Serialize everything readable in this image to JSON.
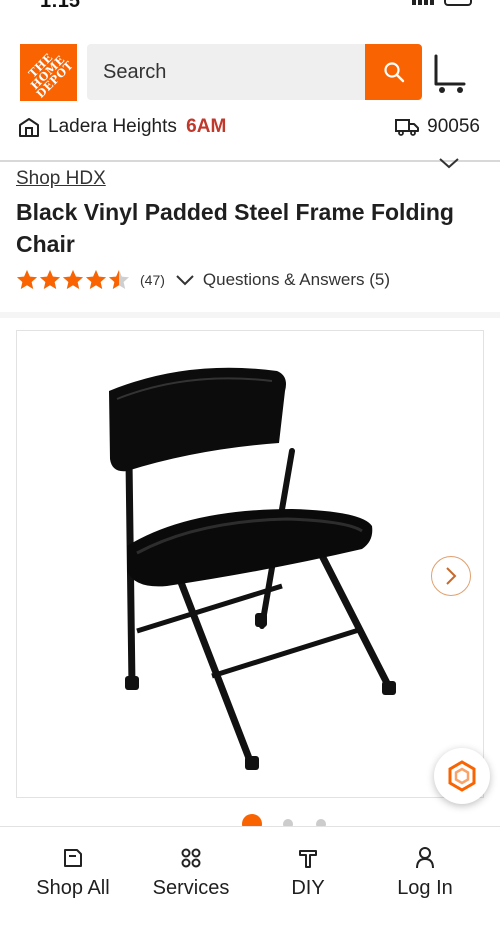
{
  "status_bar": {
    "time": "1:15"
  },
  "header": {
    "logo_text": "THE HOME DEPOT",
    "search_placeholder": "Search",
    "brand_color": "#f96302"
  },
  "location": {
    "store": "Ladera Heights",
    "store_time": "6AM",
    "zip": "90056"
  },
  "product": {
    "brand": "Shop HDX",
    "title": "Black Vinyl Padded Steel Frame Folding Chair",
    "rating": 4.5,
    "review_count": "(47)",
    "qa_label": "Questions & Answers (5)"
  },
  "gallery": {
    "image_count": 3,
    "active_index": 0
  },
  "bottom_nav": {
    "items": [
      {
        "label": "Shop All",
        "icon": "catalog-icon"
      },
      {
        "label": "Services",
        "icon": "grid-icon"
      },
      {
        "label": "DIY",
        "icon": "hammer-icon"
      },
      {
        "label": "Log In",
        "icon": "user-icon"
      }
    ]
  }
}
